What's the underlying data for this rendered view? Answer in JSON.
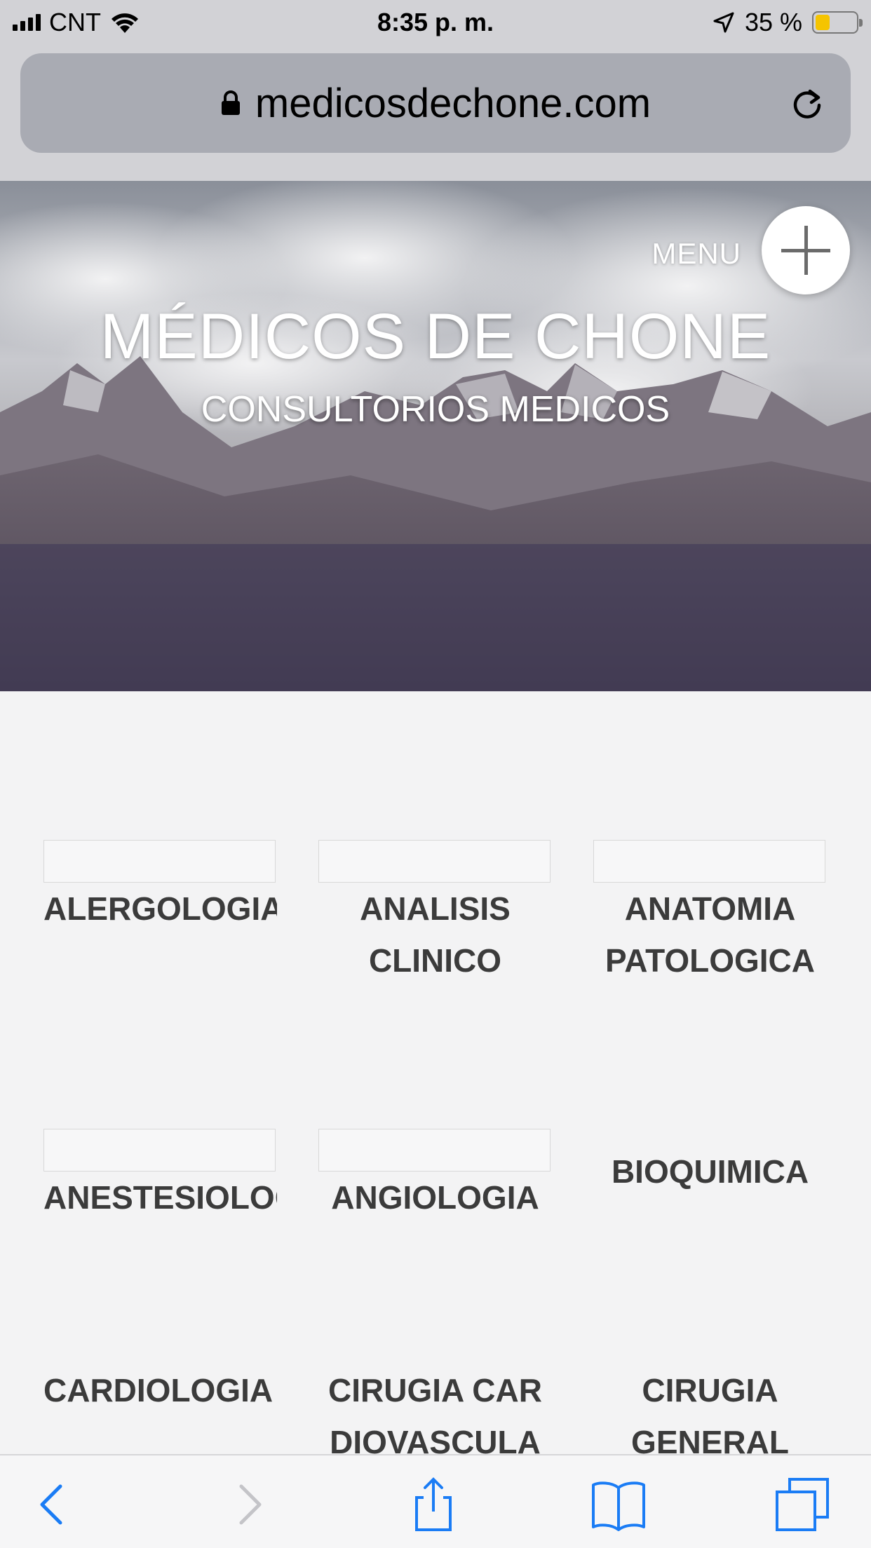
{
  "status_bar": {
    "carrier": "CNT",
    "time": "8:35 p. m.",
    "battery_percent": "35 %",
    "battery_level": 0.35,
    "icons": [
      "signal-icon",
      "wifi-icon",
      "location-arrow-icon",
      "battery-icon"
    ]
  },
  "address_bar": {
    "url": "medicosdechone.com",
    "icons": [
      "lock-icon",
      "reload-icon"
    ]
  },
  "hero": {
    "title": "MÉDICOS DE CHONE",
    "subtitle": "CONSULTORIOS MEDICOS",
    "menu_label": "MENU",
    "menu_icon": "plus-icon"
  },
  "specialties": [
    {
      "label": "ALERGOLOGIA",
      "has_image": true
    },
    {
      "label": "ANALISIS CLINICO",
      "has_image": true
    },
    {
      "label": "ANATOMIA PATOLOGICA",
      "has_image": true
    },
    {
      "label": "ANESTESIOLOGIA",
      "has_image": true
    },
    {
      "label": "ANGIOLOGIA",
      "has_image": true
    },
    {
      "label": "BIOQUIMICA",
      "has_image": false
    },
    {
      "label": "CARDIOLOGIA",
      "has_image": false
    },
    {
      "label": "CIRUGIA CARDIOVASCULAR",
      "has_image": false
    },
    {
      "label": "CIRUGIA GENERAL",
      "has_image": false
    }
  ],
  "toolbar": {
    "icons": [
      "back-icon",
      "forward-icon",
      "share-icon",
      "bookmarks-icon",
      "tabs-icon"
    ],
    "accent_color": "#1a7cf5"
  },
  "colors": {
    "background": "#f3f3f4",
    "label_text": "#3b3b3b",
    "chrome": "#d2d2d6"
  }
}
